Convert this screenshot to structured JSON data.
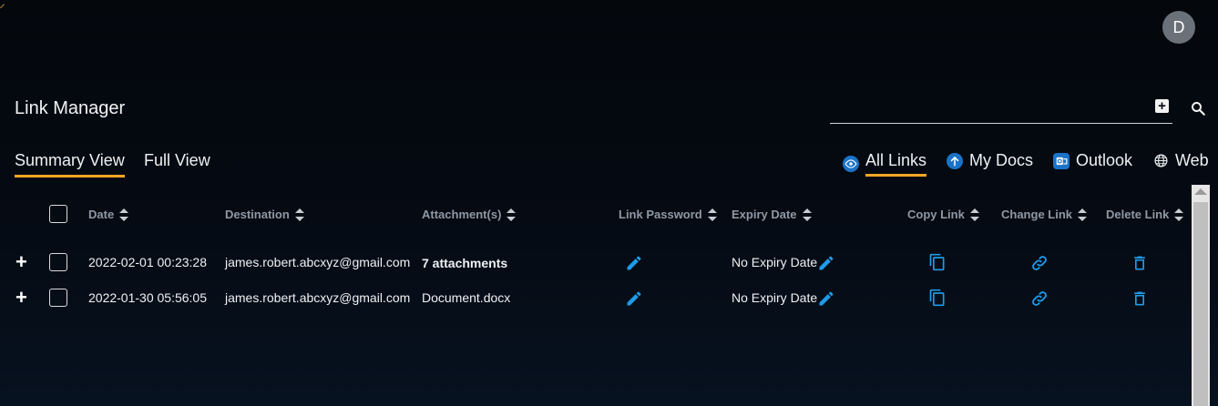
{
  "user": {
    "avatar_initial": "D"
  },
  "page": {
    "title": "Link Manager"
  },
  "search": {
    "placeholder": "",
    "value": ""
  },
  "views": [
    {
      "label": "Summary View",
      "active": true
    },
    {
      "label": "Full View",
      "active": false
    }
  ],
  "filters": [
    {
      "label": "All Links",
      "icon": "eye-icon",
      "active": true
    },
    {
      "label": "My Docs",
      "icon": "upload-icon",
      "active": false
    },
    {
      "label": "Outlook",
      "icon": "outlook-icon",
      "active": false
    },
    {
      "label": "Web",
      "icon": "globe-icon",
      "active": false
    }
  ],
  "table": {
    "columns": [
      "Date",
      "Destination",
      "Attachment(s)",
      "Link Password",
      "Expiry Date",
      "Copy Link",
      "Change Link",
      "Delete Link"
    ],
    "rows": [
      {
        "date": "2022-02-01 00:23:28",
        "destination": "james.robert.abcxyz@gmail.com",
        "attachments": "7 attachments",
        "expiry": "No Expiry Date"
      },
      {
        "date": "2022-01-30 05:56:05",
        "destination": "james.robert.abcxyz@gmail.com",
        "attachments": "Document.docx",
        "expiry": "No Expiry Date"
      }
    ]
  },
  "colors": {
    "accent": "#f5a623",
    "icon_blue": "#1e9be9",
    "badge_blue": "#1a73c8"
  }
}
